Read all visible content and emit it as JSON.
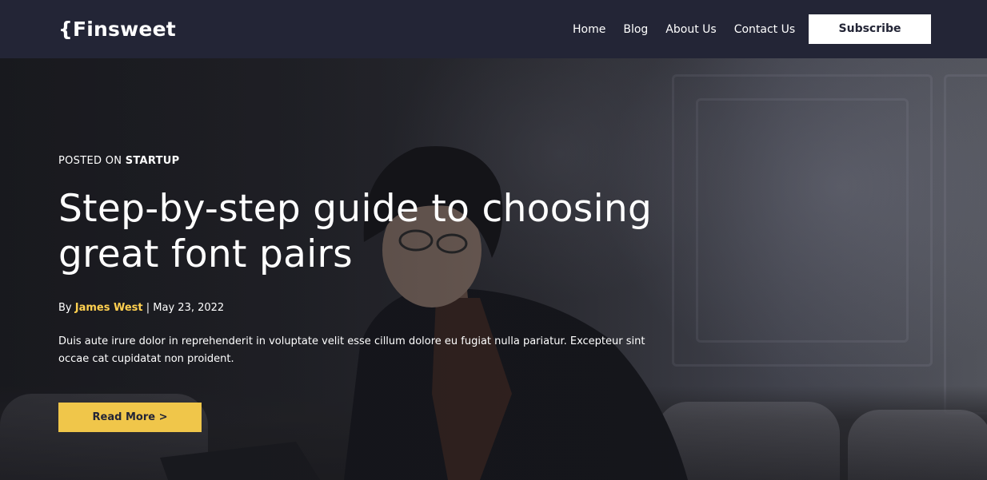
{
  "nav": {
    "logo": "{Finsweet",
    "links": [
      {
        "label": "Home"
      },
      {
        "label": "Blog"
      },
      {
        "label": "About Us"
      },
      {
        "label": "Contact Us"
      }
    ],
    "subscribe_label": "Subscribe"
  },
  "hero": {
    "posted_prefix": "POSTED ON ",
    "category": "STARTUP",
    "title": "Step-by-step guide to choosing great font pairs",
    "by_prefix": "By ",
    "author": "James West",
    "date_separator": " | ",
    "date": "May 23, 2022",
    "excerpt": "Duis aute irure dolor in reprehenderit in voluptate velit esse cillum dolore eu fugiat nulla pariatur. Excepteur sint occae cat cupidatat non proident.",
    "read_more_label": "Read More >"
  },
  "colors": {
    "nav_background": "#232536",
    "accent_yellow": "#F0C64A",
    "author_yellow": "#FFD050",
    "text_white": "#FFFFFF"
  }
}
